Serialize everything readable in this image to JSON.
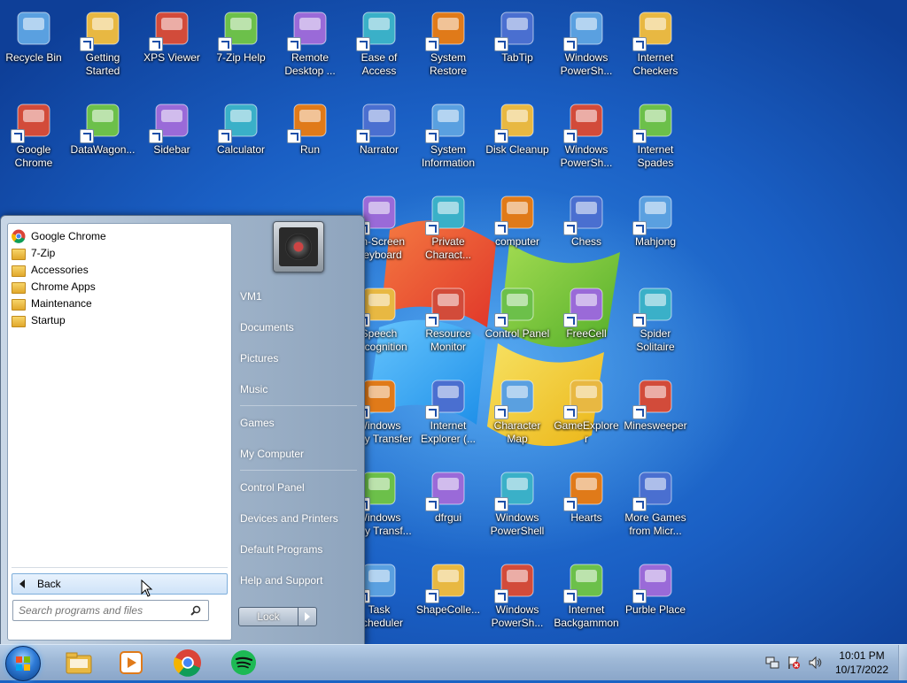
{
  "desktop_icons": [
    {
      "label": "Recycle Bin",
      "icon": "recycle-bin-icon"
    },
    {
      "label": "Getting\nStarted",
      "icon": "getting-started-icon"
    },
    {
      "label": "XPS Viewer",
      "icon": "xps-viewer-icon"
    },
    {
      "label": "7-Zip Help",
      "icon": "help-icon"
    },
    {
      "label": "Remote\nDesktop ...",
      "icon": "remote-desktop-icon"
    },
    {
      "label": "Ease of\nAccess",
      "icon": "ease-of-access-icon"
    },
    {
      "label": "System\nRestore",
      "icon": "system-restore-icon"
    },
    {
      "label": "TabTip",
      "icon": "tabtip-icon"
    },
    {
      "label": "Windows\nPowerSh...",
      "icon": "powershell-icon"
    },
    {
      "label": "Internet\nCheckers",
      "icon": "checkers-icon"
    },
    {
      "label": "Google\nChrome",
      "icon": "chrome-icon"
    },
    {
      "label": "DataWagon...",
      "icon": "datawagon-icon"
    },
    {
      "label": "Sidebar",
      "icon": "sidebar-icon"
    },
    {
      "label": "Calculator",
      "icon": "calculator-icon"
    },
    {
      "label": "Run",
      "icon": "run-icon"
    },
    {
      "label": "Narrator",
      "icon": "narrator-icon"
    },
    {
      "label": "System\nInformation",
      "icon": "system-information-icon"
    },
    {
      "label": "Disk Cleanup",
      "icon": "disk-cleanup-icon"
    },
    {
      "label": "Windows\nPowerSh...",
      "icon": "powershell-icon"
    },
    {
      "label": "Internet\nSpades",
      "icon": "spades-icon"
    },
    {
      "label": "On-Screen\nKeyboard",
      "icon": "keyboard-icon"
    },
    {
      "label": "Private\nCharact...",
      "icon": "private-character-icon"
    },
    {
      "label": "computer",
      "icon": "computer-icon"
    },
    {
      "label": "Chess",
      "icon": "chess-icon"
    },
    {
      "label": "Mahjong",
      "icon": "mahjong-icon"
    },
    {
      "label": "Speech\nRecognition",
      "icon": "microphone-icon"
    },
    {
      "label": "Resource\nMonitor",
      "icon": "resource-monitor-icon"
    },
    {
      "label": "Control Panel",
      "icon": "control-panel-icon"
    },
    {
      "label": "FreeCell",
      "icon": "freecell-icon"
    },
    {
      "label": "Spider\nSolitaire",
      "icon": "spider-solitaire-icon"
    },
    {
      "label": "Windows\nEasy Transfer",
      "icon": "easy-transfer-icon"
    },
    {
      "label": "Internet\nExplorer (...",
      "icon": "internet-explorer-icon"
    },
    {
      "label": "Character\nMap",
      "icon": "character-map-icon"
    },
    {
      "label": "GameExplorer",
      "icon": "game-explorer-icon"
    },
    {
      "label": "Minesweeper",
      "icon": "minesweeper-icon"
    },
    {
      "label": "Windows\nEasy Transf...",
      "icon": "easy-transfer-icon"
    },
    {
      "label": "dfrgui",
      "icon": "defrag-icon"
    },
    {
      "label": "Windows\nPowerShell",
      "icon": "powershell-icon"
    },
    {
      "label": "Hearts",
      "icon": "hearts-icon"
    },
    {
      "label": "More Games\nfrom Micr...",
      "icon": "more-games-icon"
    },
    {
      "label": "Task\nScheduler",
      "icon": "task-scheduler-icon"
    },
    {
      "label": "ShapeColle...",
      "icon": "shape-collector-icon"
    },
    {
      "label": "Windows\nPowerSh...",
      "icon": "powershell-icon"
    },
    {
      "label": "Internet\nBackgammon",
      "icon": "backgammon-icon"
    },
    {
      "label": "Purble Place",
      "icon": "purble-place-icon"
    }
  ],
  "start_menu": {
    "programs": [
      {
        "label": "Google Chrome",
        "icon": "chrome-icon"
      },
      {
        "label": "7-Zip",
        "icon": "folder-icon"
      },
      {
        "label": "Accessories",
        "icon": "folder-icon"
      },
      {
        "label": "Chrome Apps",
        "icon": "folder-icon"
      },
      {
        "label": "Maintenance",
        "icon": "folder-icon"
      },
      {
        "label": "Startup",
        "icon": "folder-icon"
      }
    ],
    "back_label": "Back",
    "search_placeholder": "Search programs and files",
    "right_items": [
      {
        "label": "VM1"
      },
      {
        "label": "Documents"
      },
      {
        "label": "Pictures"
      },
      {
        "label": "Music"
      },
      {
        "label": "Games"
      },
      {
        "label": "My Computer"
      },
      {
        "label": "Control Panel"
      },
      {
        "label": "Devices and Printers"
      },
      {
        "label": "Default Programs"
      },
      {
        "label": "Help and Support"
      }
    ],
    "lock_label": "Lock"
  },
  "taskbar": {
    "pinned": [
      {
        "icon": "explorer-folder-icon"
      },
      {
        "icon": "media-player-icon"
      },
      {
        "icon": "chrome-icon"
      },
      {
        "icon": "spotify-icon"
      }
    ],
    "tray": [
      {
        "icon": "network-icon"
      },
      {
        "icon": "action-center-flag-icon"
      },
      {
        "icon": "volume-icon"
      }
    ],
    "time": "10:01 PM",
    "date": "10/17/2022"
  },
  "colors": {
    "desktop_blue": "#1a63c4",
    "taskbar": "#9db7d6",
    "start_menu_right": "#9fb3c9"
  }
}
